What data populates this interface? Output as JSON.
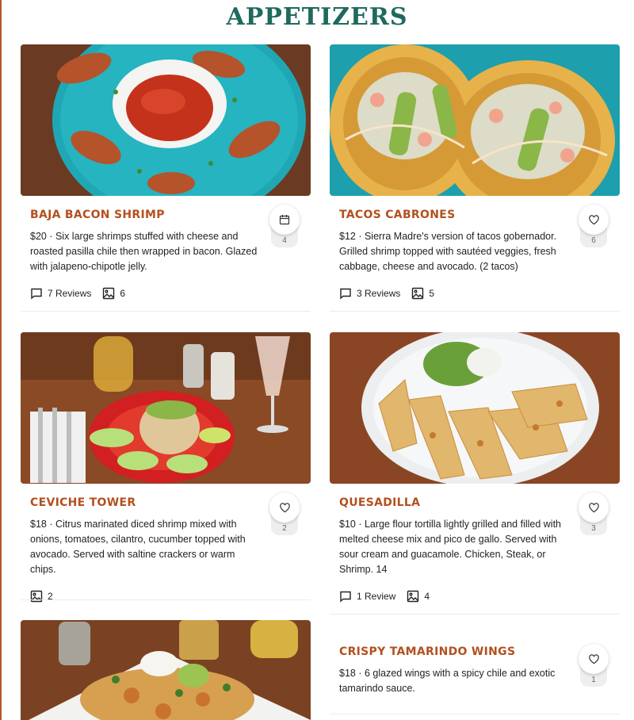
{
  "section": {
    "title": "APPETIZERS"
  },
  "items": [
    {
      "name": "BAJA BACON SHRIMP",
      "description": "$20 · Six large shrimps stuffed with cheese and roasted pasilla chile then wrapped in bacon. Glazed with jalapeno-chipotle jelly.",
      "fav_icon": "calendar-icon",
      "fav_count": "4",
      "reviews": "7 Reviews",
      "photos": "6"
    },
    {
      "name": "TACOS CABRONES",
      "description": "$12 · Sierra Madre's version of tacos gobernador. Grilled shrimp topped with sautéed veggies, fresh cabbage, cheese and avocado. (2 tacos)",
      "fav_icon": "heart-icon",
      "fav_count": "6",
      "reviews": "3 Reviews",
      "photos": "5"
    },
    {
      "name": "CEVICHE TOWER",
      "description": "$18 · Citrus marinated diced shrimp mixed with onions, tomatoes, cilantro, cucumber topped with avocado. Served with saltine crackers or warm chips.",
      "fav_icon": "heart-icon",
      "fav_count": "2",
      "photos": "2"
    },
    {
      "name": "QUESADILLA",
      "description": "$10 · Large flour tortilla lightly grilled and filled with melted cheese mix and pico de gallo. Served with sour cream and guacamole. Chicken, Steak, or Shrimp. 14",
      "fav_icon": "heart-icon",
      "fav_count": "3",
      "reviews": "1 Review",
      "photos": "4"
    },
    {
      "name": "CRISPY TAMARINDO WINGS",
      "description": "$18 · 6 glazed wings with a spicy chile and exotic tamarindo sauce.",
      "fav_icon": "heart-icon",
      "fav_count": "1"
    }
  ],
  "colors": {
    "title": "#1f6a5e",
    "item_name": "#b3501f",
    "accent_rule": "#b5562a"
  }
}
